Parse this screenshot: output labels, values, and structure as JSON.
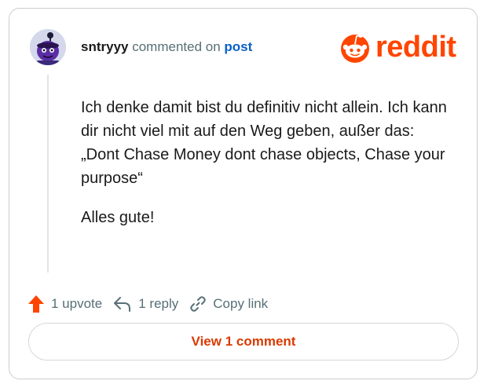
{
  "header": {
    "username": "sntryyy",
    "commented_on": "commented on",
    "post_link": "post"
  },
  "logo": {
    "wordmark": "reddit",
    "brand_color": "#ff4500"
  },
  "comment": {
    "paragraphs": [
      "Ich denke damit bist du definitiv nicht allein. Ich kann dir nicht viel mit auf den Weg geben, außer das: „Dont Chase Money dont chase objects, Chase your purpose“",
      "Alles gute!"
    ]
  },
  "actions": {
    "upvote_icon": "arrow-up-icon",
    "upvote_label": "1 upvote",
    "reply_icon": "reply-arrow-icon",
    "reply_label": "1 reply",
    "copy_icon": "link-icon",
    "copy_label": "Copy link"
  },
  "footer": {
    "view_label": "View 1 comment",
    "accent_color": "#d93a00"
  }
}
